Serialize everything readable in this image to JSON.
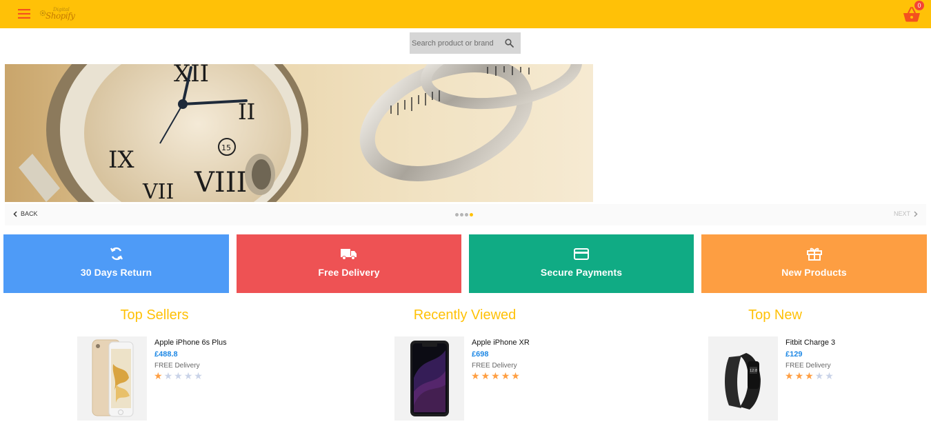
{
  "header": {
    "menu_icon": "hamburger-menu-icon",
    "logo": {
      "small": "Digital",
      "big": "Shopify"
    },
    "cart": {
      "icon": "shopping-basket-icon",
      "count": "0"
    }
  },
  "search": {
    "placeholder": "Search product or brand",
    "value": "",
    "icon": "search-icon"
  },
  "carousel": {
    "back_label": "BACK",
    "next_label": "NEXT",
    "total_slides": 4,
    "active_slide": 4
  },
  "features": [
    {
      "label": "30 Days Return",
      "icon": "refresh-icon",
      "color": "#4e9bf7"
    },
    {
      "label": "Free Delivery",
      "icon": "truck-icon",
      "color": "#ee5254"
    },
    {
      "label": "Secure Payments",
      "icon": "credit-card-icon",
      "color": "#10ab84"
    },
    {
      "label": "New Products",
      "icon": "gift-icon",
      "color": "#fd9e42"
    }
  ],
  "sections": [
    {
      "title": "Top Sellers",
      "product": {
        "name": "Apple iPhone 6s Plus",
        "price": "£488.8",
        "delivery": "FREE Delivery",
        "rating": 1,
        "max_rating": 5
      }
    },
    {
      "title": "Recently Viewed",
      "product": {
        "name": "Apple iPhone XR",
        "price": "£698",
        "delivery": "FREE Delivery",
        "rating": 5,
        "max_rating": 5
      }
    },
    {
      "title": "Top New",
      "product": {
        "name": "Fitbit Charge 3",
        "price": "£129",
        "delivery": "FREE Delivery",
        "rating": 3,
        "max_rating": 5
      }
    }
  ],
  "colors": {
    "header": "#ffc107",
    "accent": "#ffc107",
    "price": "#1e88e5",
    "star": "#ff9f43"
  }
}
